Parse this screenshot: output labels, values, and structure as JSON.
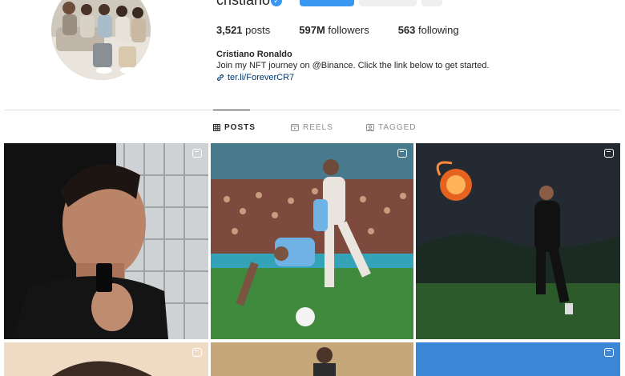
{
  "profile": {
    "username": "cristiano",
    "posts_count": "3,521",
    "posts_label": "posts",
    "followers_count": "597M",
    "followers_label": "followers",
    "following_count": "563",
    "following_label": "following",
    "full_name": "Cristiano Ronaldo",
    "bio": "Join my NFT journey on @Binance. Click the link below to get started.",
    "link": "ter.li/ForeverCR7"
  },
  "tabs": [
    {
      "label": "POSTS",
      "icon": "grid-icon",
      "active": true
    },
    {
      "label": "REELS",
      "icon": "reels-icon",
      "active": false
    },
    {
      "label": "TAGGED",
      "icon": "tagged-icon",
      "active": false
    }
  ],
  "grid": {
    "tiles": [
      {
        "type": "reel"
      },
      {
        "type": "carousel"
      },
      {
        "type": "reel"
      },
      {
        "type": "photo"
      },
      {
        "type": "photo"
      },
      {
        "type": "carousel"
      }
    ]
  },
  "colors": {
    "accent": "#3897f0",
    "link": "#00376b",
    "text": "#262626",
    "muted": "#8e8e8e",
    "divider": "#dbdbdb"
  }
}
